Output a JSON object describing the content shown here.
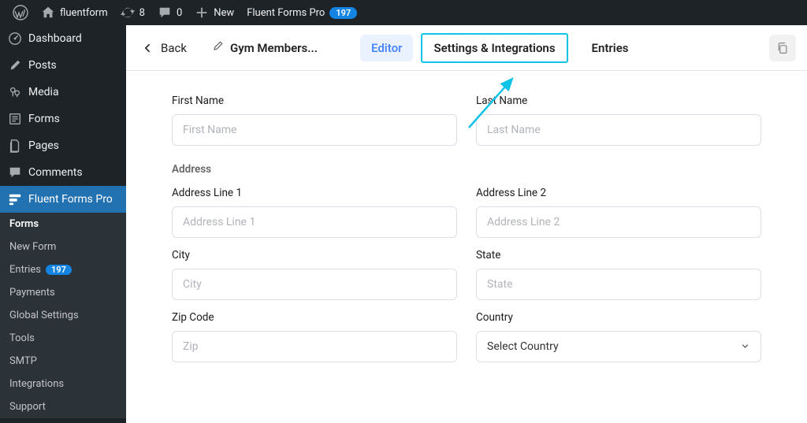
{
  "adminBar": {
    "site": "fluentform",
    "updates": "8",
    "comments": "0",
    "new": "New",
    "plugin": "Fluent Forms Pro",
    "pluginCount": "197"
  },
  "sidebar": {
    "dashboard": "Dashboard",
    "posts": "Posts",
    "media": "Media",
    "forms": "Forms",
    "pages": "Pages",
    "comments": "Comments",
    "fluentFormsPro": "Fluent Forms Pro",
    "sub": {
      "forms": "Forms",
      "newForm": "New Form",
      "entries": "Entries",
      "entriesCount": "197",
      "payments": "Payments",
      "globalSettings": "Global Settings",
      "tools": "Tools",
      "smtp": "SMTP",
      "integrations": "Integrations",
      "support": "Support"
    }
  },
  "tabsBar": {
    "back": "Back",
    "formName": "Gym Members...",
    "editor": "Editor",
    "settings": "Settings & Integrations",
    "entries": "Entries"
  },
  "form": {
    "firstName": {
      "label": "First Name",
      "placeholder": "First Name"
    },
    "lastName": {
      "label": "Last Name",
      "placeholder": "Last Name"
    },
    "addressSection": "Address",
    "addr1": {
      "label": "Address Line 1",
      "placeholder": "Address Line 1"
    },
    "addr2": {
      "label": "Address Line 2",
      "placeholder": "Address Line 2"
    },
    "city": {
      "label": "City",
      "placeholder": "City"
    },
    "state": {
      "label": "State",
      "placeholder": "State"
    },
    "zip": {
      "label": "Zip Code",
      "placeholder": "Zip"
    },
    "country": {
      "label": "Country",
      "selected": "Select Country"
    }
  }
}
